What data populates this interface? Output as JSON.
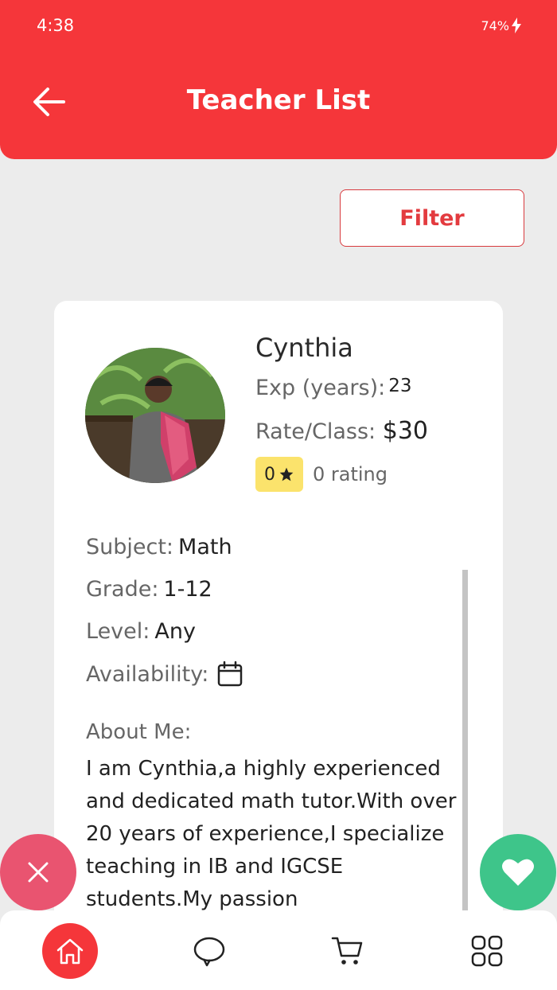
{
  "status_bar": {
    "time": "4:38",
    "battery": "74%"
  },
  "header": {
    "title": "Teacher List"
  },
  "filter": {
    "label": "Filter"
  },
  "teacher": {
    "name": "Cynthia",
    "exp_label": "Exp (years):",
    "exp_value": "23",
    "rate_label": "Rate/Class:",
    "rate_value": "$30",
    "rating_value": "0",
    "rating_text": "0 rating",
    "subject_label": "Subject:",
    "subject_value": "Math",
    "grade_label": "Grade:",
    "grade_value": "1-12",
    "level_label": "Level:",
    "level_value": "Any",
    "availability_label": "Availability:",
    "about_label": "About Me:",
    "about_text": "I am Cynthia,a highly experienced and dedicated math tutor.With over 20 years of experience,I specialize teaching in IB and IGCSE students.My passion"
  },
  "colors": {
    "primary": "#f5363a",
    "reject": "#e95470",
    "like": "#3ec58a",
    "badge": "#fbe36c"
  },
  "icons": {
    "back": "arrow-left-icon",
    "calendar": "calendar-icon",
    "star": "star-icon",
    "reject": "close-icon",
    "like": "heart-icon",
    "nav": [
      "home-icon",
      "chat-icon",
      "cart-icon",
      "grid-icon"
    ]
  }
}
